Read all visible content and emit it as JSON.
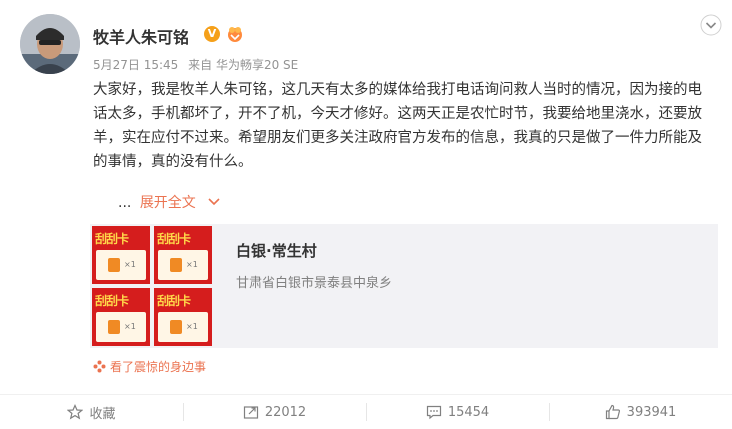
{
  "user": {
    "name": "牧羊人朱可铭",
    "verified_badge": "V",
    "colors": {
      "verified": "#f5a01a",
      "accent": "#eb7350"
    }
  },
  "post": {
    "date": "5月27日 15:45",
    "source": "来自 华为畅享20 SE",
    "text": "大家好，我是牧羊人朱可铭，这几天有太多的媒体给我打电话询问救人当时的情况，因为接的电话太多，手机都坏了，开不了机，今天才修好。这两天正是农忙时节，我要给地里浇水，还要放羊，实在应付不过来。希望朋友们更多关注政府官方发布的信息，我真的只是做了一件力所能及的事情，真的没有什么。",
    "ellipsis": "...",
    "expand_label": "展开全文"
  },
  "location_card": {
    "title": "白银·常生村",
    "subtitle": "甘肃省白银市景泰县中泉乡",
    "thumb_label": "刮刮卡",
    "thumb_qty": "×1"
  },
  "source_link": "看了震惊的身边事",
  "actions": {
    "favorite_label": "收藏",
    "repost_count": "22012",
    "comment_count": "15454",
    "like_count": "393941"
  }
}
